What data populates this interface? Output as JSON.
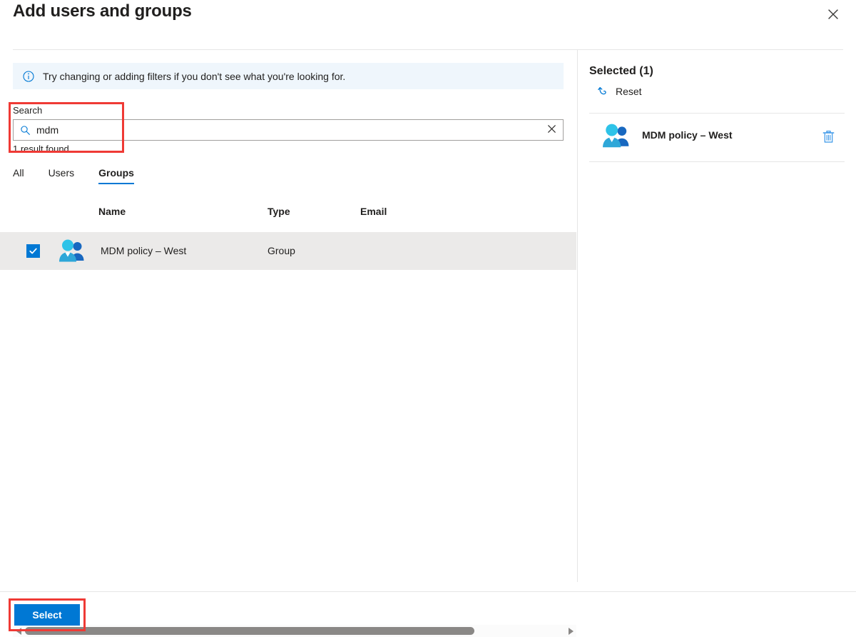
{
  "dialog": {
    "title": "Add users and groups",
    "close_icon": "close-icon"
  },
  "info_banner": {
    "icon": "info-icon",
    "text": "Try changing or adding filters if you don't see what you're looking for."
  },
  "search": {
    "label": "Search",
    "value": "mdm",
    "placeholder": "Search",
    "search_icon": "search-icon",
    "clear_icon": "clear-icon",
    "result_count": "1 result found"
  },
  "tabs": [
    {
      "label": "All",
      "active": false
    },
    {
      "label": "Users",
      "active": false
    },
    {
      "label": "Groups",
      "active": true
    }
  ],
  "table": {
    "columns": [
      "Name",
      "Type",
      "Email"
    ],
    "rows": [
      {
        "checked": true,
        "icon": "group-icon",
        "name": "MDM policy – West",
        "type": "Group",
        "email": ""
      }
    ]
  },
  "scrollbar": {
    "left_arrow_icon": "triangle-left-icon",
    "right_arrow_icon": "triangle-right-icon"
  },
  "footer": {
    "select_label": "Select"
  },
  "selected_panel": {
    "title": "Selected (1)",
    "reset_label": "Reset",
    "reset_icon": "undo-icon",
    "items": [
      {
        "icon": "group-icon",
        "name": "MDM policy – West",
        "delete_icon": "trash-icon"
      }
    ]
  },
  "annotations": {
    "accent_red": "#ef3a35",
    "accent_blue": "#0078d4"
  }
}
